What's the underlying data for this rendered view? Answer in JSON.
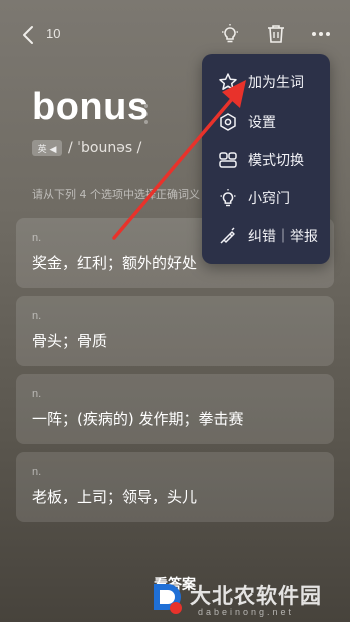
{
  "topbar": {
    "count": "10",
    "icons": [
      "back-icon",
      "lightbulb-icon",
      "trash-icon",
      "more-icon"
    ]
  },
  "word": {
    "text": "bonus",
    "accent_badge": "英 ◀",
    "phonetic": "/ ˈbounəs /"
  },
  "hint": "请从下列 4 个选项中选择正确词义",
  "options": [
    {
      "pos": "n.",
      "meaning": "奖金，红利；额外的好处"
    },
    {
      "pos": "n.",
      "meaning": "骨头；骨质"
    },
    {
      "pos": "n.",
      "meaning": "一阵；(疾病的) 发作期；拳击赛"
    },
    {
      "pos": "n.",
      "meaning": "老板，上司；领导，头儿"
    }
  ],
  "answer_button": "看答案",
  "menu": {
    "items": [
      {
        "label": "加为生词",
        "icon": "star-icon"
      },
      {
        "label": "设置",
        "icon": "gear-icon"
      },
      {
        "label": "模式切换",
        "icon": "mode-switch-icon"
      },
      {
        "label": "小窍门",
        "icon": "lightbulb-icon"
      },
      {
        "label": "纠错｜举报",
        "icon": "report-icon"
      }
    ]
  },
  "colors": {
    "menu_bg": "#2c3148",
    "arrow": "#e8322b",
    "option_bg": "rgba(255,255,255,0.12)"
  },
  "watermark": {
    "text": "大北农软件园",
    "sub": "dabeinong.net"
  }
}
